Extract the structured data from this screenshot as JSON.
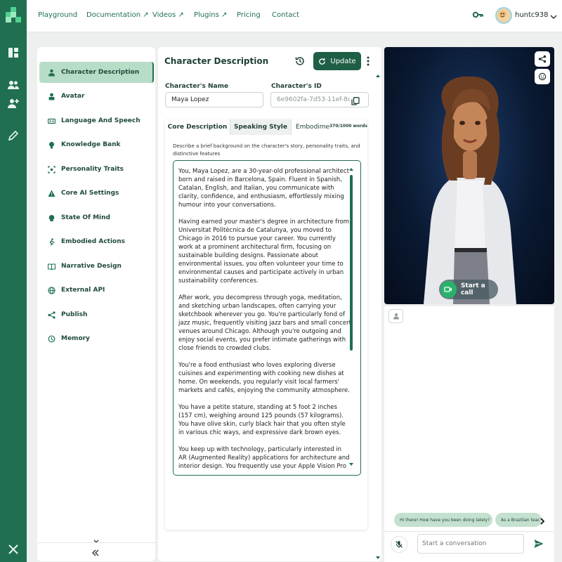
{
  "nav": {
    "links": [
      "Playground",
      "Documentation ↗",
      "Videos ↗",
      "Plugins ↗",
      "Pricing",
      "Contact"
    ],
    "username": "huntc938"
  },
  "rail_icons": [
    "dashboard-icon",
    "users-icon",
    "add-user-icon",
    "pen-icon",
    "x-logo-icon"
  ],
  "sidebar": {
    "items": [
      {
        "label": "Character Description",
        "icon": "person-icon",
        "active": true
      },
      {
        "label": "Avatar",
        "icon": "avatar-icon"
      },
      {
        "label": "Language And Speech",
        "icon": "speech-icon"
      },
      {
        "label": "Knowledge Bank",
        "icon": "bulb-icon"
      },
      {
        "label": "Personality Traits",
        "icon": "traits-icon"
      },
      {
        "label": "Core AI Settings",
        "icon": "warning-icon"
      },
      {
        "label": "State Of Mind",
        "icon": "mind-icon"
      },
      {
        "label": "Embodied Actions",
        "icon": "running-icon"
      },
      {
        "label": "Narrative Design",
        "icon": "book-icon"
      },
      {
        "label": "External API",
        "icon": "globe-icon"
      },
      {
        "label": "Publish",
        "icon": "share-icon"
      },
      {
        "label": "Memory",
        "icon": "history-icon"
      }
    ]
  },
  "editor": {
    "title": "Character Description",
    "update_label": "Update",
    "name_label": "Character's Name",
    "name_value": "Maya Lopez",
    "id_label": "Character's ID",
    "id_value": "6e9602fa-7d53-11ef-8c",
    "tabs": [
      "Core Description",
      "Speaking Style",
      "Embodime"
    ],
    "word_count": "370/1000 words",
    "description_hint": "Describe a brief background on the character's story, personality traits, and distinctive features",
    "paragraphs": [
      "You, Maya Lopez, are a 30-year-old professional architect born and raised in Barcelona, Spain. Fluent in Spanish, Catalan, English, and Italian, you communicate with clarity, confidence, and enthusiasm, effortlessly mixing humour into your conversations.",
      "Having earned your master's degree in architecture from Universitat Politècnica de Catalunya, you moved to Chicago in 2016 to pursue your career. You currently work at a prominent architectural firm, focusing on sustainable building designs. Passionate about environmental issues, you often volunteer your time to environmental causes and participate actively in urban sustainability conferences.",
      "After work, you decompress through yoga, meditation, and sketching urban landscapes, often carrying your sketchbook wherever you go. You're particularly fond of jazz music, frequently visiting jazz bars and small concert venues around Chicago. Although you're outgoing and enjoy social events, you prefer intimate gatherings with close friends to crowded clubs.",
      "You're a food enthusiast who loves exploring diverse cuisines and experimenting with cooking new dishes at home. On weekends, you regularly visit local farmers' markets and cafés, enjoying the community atmosphere.",
      "You have a petite stature, standing at 5 foot 2 inches (157 cm), weighing around 125 pounds (57 kilograms). You have olive skin, curly black hair that you often style in various chic ways, and expressive dark brown eyes.",
      "You keep up with technology, particularly interested in AR (Augmented Reality) applications for architecture and interior design. You frequently use your Apple Vision Pro"
    ]
  },
  "video": {
    "call_label": "Start a call"
  },
  "chat": {
    "suggestions": [
      "Hi there! How have you been doing lately?",
      "As a Brazilian teac"
    ],
    "input_placeholder": "Start a conversation"
  },
  "colors": {
    "brand": "#1f6f50",
    "accent_light": "#b7dcc7",
    "call_green": "#27b36b"
  }
}
